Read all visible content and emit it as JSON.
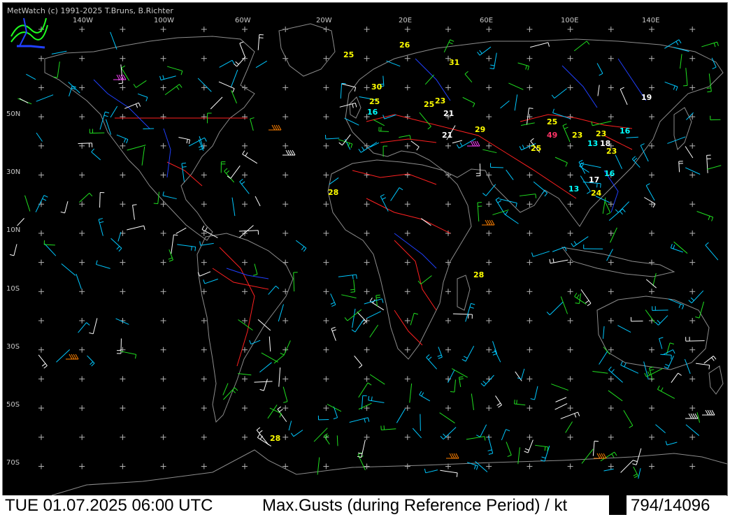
{
  "copyright": "MetWatch (c) 1991-2025 T.Bruns, B.Richter",
  "status": {
    "datetime": "TUE 01.07.2025 06:00 UTC",
    "product": "Max.Gusts (during Reference Period) / kt",
    "counter": "794/14096"
  },
  "longitude_labels": [
    "140W",
    "100W",
    "60W",
    "20W",
    "20E",
    "60E",
    "100E",
    "140E"
  ],
  "latitude_labels": [
    "50N",
    "30N",
    "10N",
    "10S",
    "30S",
    "50S",
    "70S"
  ],
  "gust_values": [
    {
      "value": "25",
      "color": "#ffff00"
    },
    {
      "value": "26",
      "color": "#ffff00"
    },
    {
      "value": "31",
      "color": "#ffff00"
    },
    {
      "value": "30",
      "color": "#ffff00"
    },
    {
      "value": "25",
      "color": "#ffff00"
    },
    {
      "value": "16",
      "color": "#00ffff"
    },
    {
      "value": "23",
      "color": "#ffff00"
    },
    {
      "value": "25",
      "color": "#ffff00"
    },
    {
      "value": "21",
      "color": "#ffffff"
    },
    {
      "value": "21",
      "color": "#ffffff"
    },
    {
      "value": "29",
      "color": "#ffff00"
    },
    {
      "value": "19",
      "color": "#ffffff"
    },
    {
      "value": "25",
      "color": "#ffff00"
    },
    {
      "value": "49",
      "color": "#ff3366"
    },
    {
      "value": "23",
      "color": "#ffff00"
    },
    {
      "value": "23",
      "color": "#ffff00"
    },
    {
      "value": "16",
      "color": "#00ffff"
    },
    {
      "value": "13",
      "color": "#00ffff"
    },
    {
      "value": "18",
      "color": "#ffffff"
    },
    {
      "value": "23",
      "color": "#ffff00"
    },
    {
      "value": "25",
      "color": "#ffff00"
    },
    {
      "value": "16",
      "color": "#00ffff"
    },
    {
      "value": "17",
      "color": "#ffffff"
    },
    {
      "value": "13",
      "color": "#00ffff"
    },
    {
      "value": "24",
      "color": "#ffff00"
    },
    {
      "value": "28",
      "color": "#ffff00"
    },
    {
      "value": "28",
      "color": "#ffff00"
    },
    {
      "value": "28",
      "color": "#ffff00"
    }
  ],
  "colors": {
    "background": "#000000",
    "coastline": "#8c8c8c",
    "borders": "#ff2020",
    "rivers": "#2040ff",
    "grid_marker": "#b4b4b4",
    "barb_low": "#00c8ff",
    "barb_mid": "#20e020",
    "barb_high": "#ffffff",
    "barb_strong": "#ff8000",
    "barb_extreme": "#ff40ff"
  },
  "logo_icon": "metwatch-logo-icon"
}
